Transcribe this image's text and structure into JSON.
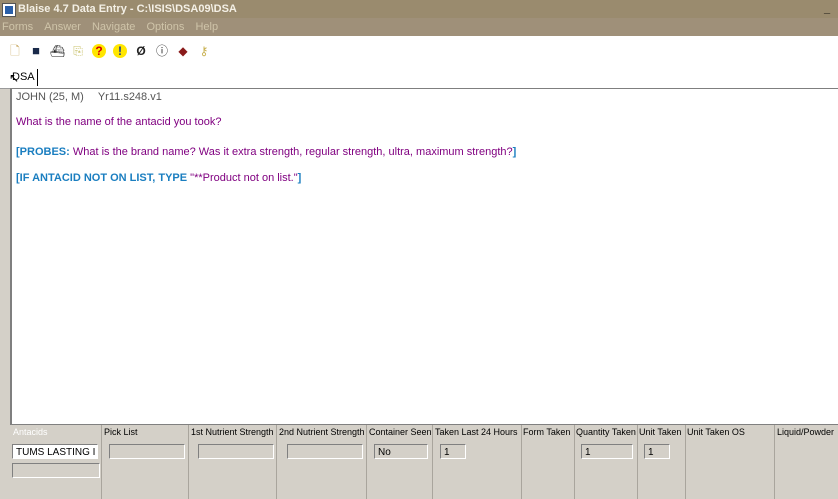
{
  "window": {
    "title": "Blaise 4.7 Data Entry - C:\\ISIS\\DSA09\\DSA",
    "minimize_label": "_"
  },
  "menu": [
    "Forms",
    "Answer",
    "Navigate",
    "Options",
    "Help"
  ],
  "toolbar": {
    "icons": [
      "new-icon",
      "save-icon",
      "find-icon",
      "copy-icon",
      "help-icon",
      "info-icon",
      "clip-icon",
      "info-circle-icon",
      "tag-icon",
      "key-icon"
    ],
    "glyphs": [
      "🗋",
      "■",
      "⛴",
      "⎘",
      "?",
      "!",
      "Ø",
      "ⓘ",
      "◆",
      "⚷"
    ]
  },
  "tab": {
    "label": "DSA"
  },
  "form": {
    "respondent": "JOHN (25, M)",
    "version": "Yr11.s248.v1",
    "question": "What is the name of the antacid you took?",
    "probe_open": "[PROBES:",
    "probe_text": " What is the brand name?  Was it extra strength, regular strength, ultra, maximum strength?",
    "probe_close": "]",
    "if_text": "[IF ANTACID NOT ON LIST, TYPE ",
    "if_quote": "\"**Product not on list.\"",
    "if_close": "]"
  },
  "grid": {
    "columns": [
      "Antacids",
      "Pick List",
      "1st Nutrient Strength",
      "2nd Nutrient Strength",
      "Container Seen",
      "Taken Last 24 Hours",
      "Form Taken",
      "Quantity Taken",
      "Unit Taken",
      "Unit Taken OS",
      "Liquid/Powder"
    ],
    "row": {
      "antacids": "TUMS LASTING I",
      "pick_list": "",
      "first_strength": "",
      "second_strength": "",
      "container_seen": "No",
      "taken_24h": "1",
      "quantity_taken": "1",
      "unit_taken": "1"
    }
  }
}
